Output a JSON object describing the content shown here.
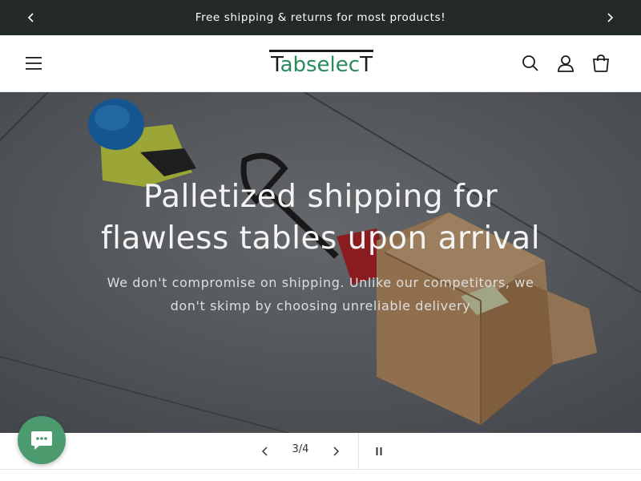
{
  "announcement": {
    "message": "Free shipping & returns for most products!",
    "prev_icon": "chevron-left-icon",
    "next_icon": "chevron-right-icon"
  },
  "header": {
    "logo": {
      "text_t": "T",
      "text_middle": "abselec",
      "text_end": "T"
    },
    "icons": [
      "menu-icon",
      "search-icon",
      "account-icon",
      "cart-icon"
    ]
  },
  "hero": {
    "title": "Palletized shipping for flawless tables upon arrival",
    "subtitle": "We don't compromise on shipping. Unlike our competitors, we don't skimp by choosing unreliable delivery"
  },
  "slideshow": {
    "counter": "3/4",
    "current": 3,
    "total": 4
  },
  "colors": {
    "announcement_bg": "#242b27",
    "brand_green": "#2a8a5c",
    "chat_green": "#4b9b6e"
  }
}
